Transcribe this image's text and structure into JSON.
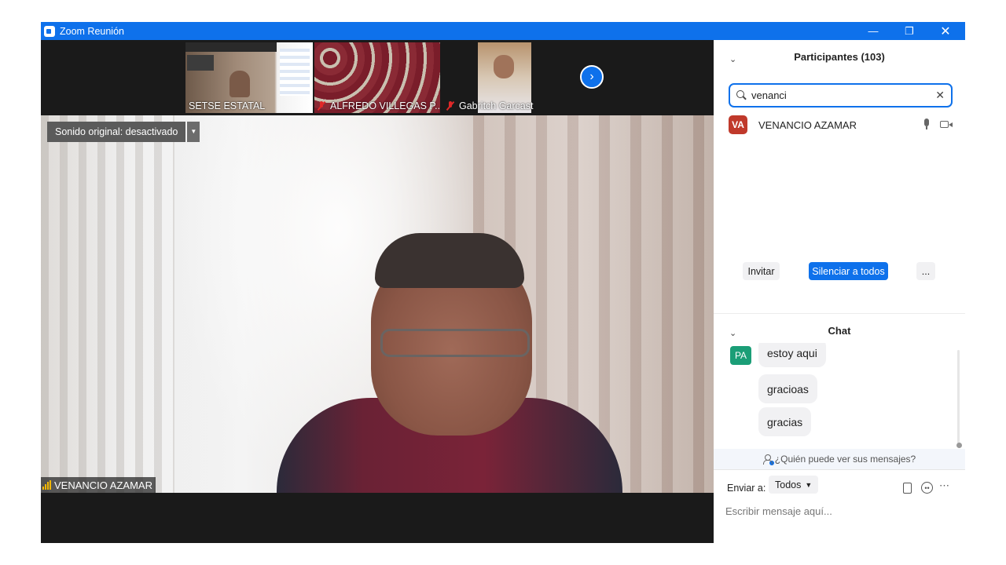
{
  "window": {
    "title": "Zoom Reunión"
  },
  "thumbnails": [
    {
      "name": "SETSE ESTATAL",
      "muted": false
    },
    {
      "name": "ALFREDO VILLEGAS P...",
      "muted": true
    },
    {
      "name": "Gabritch Garcast",
      "muted": true
    }
  ],
  "main_video": {
    "sound_label": "Sonido original: desactivado",
    "speaker_name": "VENANCIO AZAMAR"
  },
  "participants": {
    "title": "Participantes (103)",
    "search_value": "venanci",
    "results": [
      {
        "initials": "VA",
        "name": "VENANCIO AZAMAR"
      }
    ],
    "invite_label": "Invitar",
    "mute_all_label": "Silenciar a todos",
    "more_label": "..."
  },
  "chat": {
    "title": "Chat",
    "sender_initials": "PA",
    "messages": [
      "estoy aqui",
      "gracioas",
      "gracias"
    ],
    "visibility_text": "¿Quién puede ver sus mensajes?",
    "send_to_label": "Enviar a:",
    "recipient": "Todos",
    "input_placeholder": "Escribir mensaje aquí..."
  },
  "colors": {
    "accent": "#0e71eb",
    "avatar_va": "#c0392b",
    "avatar_pa": "#1b9e77",
    "audio_level": "#f3b700"
  },
  "icons": [
    "zoom-logo-icon",
    "minimize-icon",
    "restore-icon",
    "close-icon",
    "next-page-icon",
    "muted-mic-icon",
    "signal-bars-icon",
    "search-icon",
    "clear-icon",
    "mic-icon",
    "camera-icon",
    "person-icon",
    "file-icon",
    "emoji-icon",
    "more-icon",
    "chevron-down-icon"
  ]
}
